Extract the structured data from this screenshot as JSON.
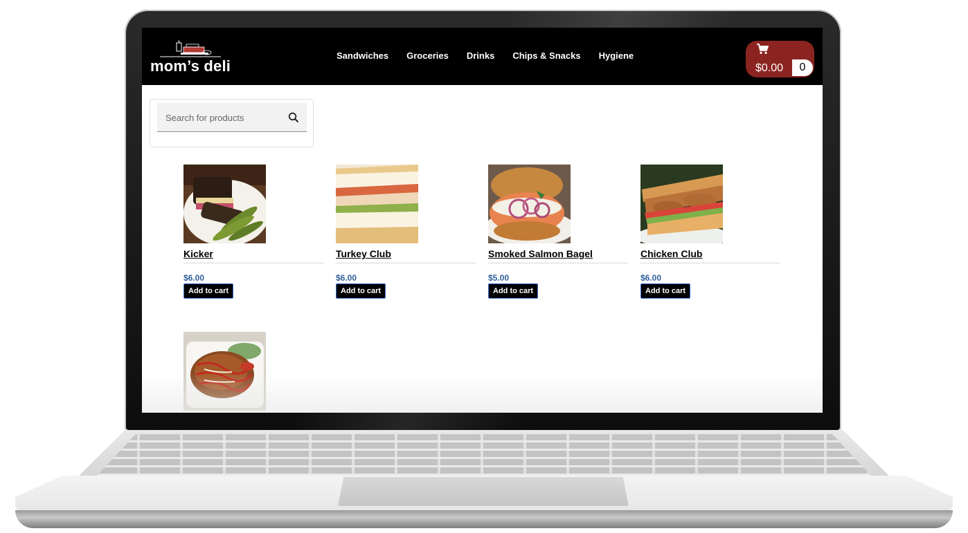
{
  "header": {
    "logo_text": "mom’s deli",
    "nav": [
      "Sandwiches",
      "Groceries",
      "Drinks",
      "Chips & Snacks",
      "Hygiene"
    ],
    "cart": {
      "total": "$0.00",
      "count": "0",
      "icon": "shopping-cart-icon"
    }
  },
  "search": {
    "placeholder": "Search for products",
    "icon": "search-icon"
  },
  "products": [
    {
      "name": "Kicker",
      "price": "$6.00",
      "button": "Add to cart"
    },
    {
      "name": "Turkey Club",
      "price": "$6.00",
      "button": "Add to cart"
    },
    {
      "name": "Smoked Salmon Bagel",
      "price": "$5.00",
      "button": "Add to cart"
    },
    {
      "name": "Chicken Club",
      "price": "$6.00",
      "button": "Add to cart"
    }
  ],
  "colors": {
    "header_bg": "#000000",
    "cart_bg": "#8b2420",
    "price": "#2f5f9a",
    "button_bg": "#000000"
  }
}
